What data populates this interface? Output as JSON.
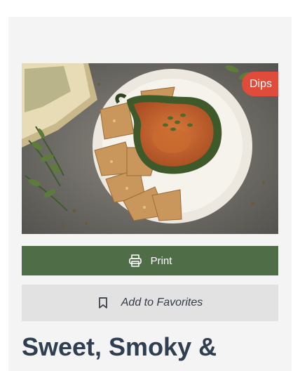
{
  "recipe": {
    "category_badge": "Dips",
    "title": "Sweet, Smoky &"
  },
  "actions": {
    "print_label": "Print",
    "favorite_label": "Add to Favorites"
  },
  "icons": {
    "print": "printer-icon",
    "favorite": "bookmark-icon"
  },
  "colors": {
    "badge": "#e04b3a",
    "print_button": "#4f6e48",
    "favorite_button": "#e2e2e2",
    "title": "#2f3e50"
  }
}
